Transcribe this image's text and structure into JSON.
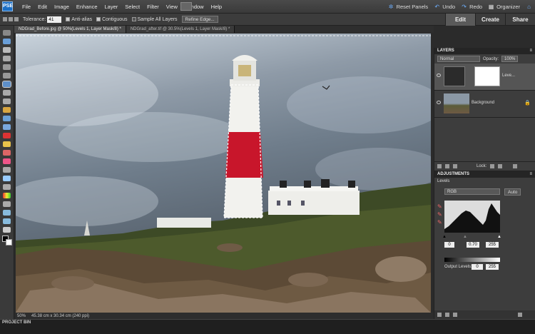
{
  "app": {
    "logo_text": "PSE"
  },
  "menu": [
    "File",
    "Edit",
    "Image",
    "Enhance",
    "Layer",
    "Select",
    "Filter",
    "View",
    "Window",
    "Help"
  ],
  "top_actions": {
    "reset_panels": "Reset Panels",
    "undo": "Undo",
    "redo": "Redo",
    "organizer": "Organizer"
  },
  "modes": {
    "edit": "Edit",
    "create": "Create",
    "share": "Share"
  },
  "options": {
    "tolerance_label": "Tolerance:",
    "tolerance_value": "41",
    "anti_alias": "Anti-alias",
    "contiguous": "Contiguous",
    "sample_all": "Sample All Layers",
    "refine_edge": "Refine Edge..."
  },
  "doc_tabs": [
    {
      "label": "NDGrad_Before.jpg @ 50%(Levels 1, Layer Mask/8) *",
      "active": true
    },
    {
      "label": "NDGrad_after.tif @ 30.5%(Levels 1, Layer Mask/8) *",
      "active": false
    }
  ],
  "status": {
    "zoom": "50%",
    "size": "45.38 cm x 30.34 cm (240 ppi)"
  },
  "project_bin": "PROJECT BIN",
  "layers_panel": {
    "title": "LAYERS",
    "blend_mode": "Normal",
    "opacity_label": "Opacity:",
    "opacity_value": "100%",
    "layers": [
      {
        "name": "Leve...",
        "selected": true
      },
      {
        "name": "Background",
        "selected": false
      }
    ],
    "lock_label": "Lock:"
  },
  "adjustments_panel": {
    "title": "ADJUSTMENTS",
    "type": "Levels",
    "channel": "RGB",
    "auto_label": "Auto",
    "input_black": "0",
    "input_mid": "0.70",
    "input_white": "255",
    "output_label": "Output Levels:",
    "output_black": "0",
    "output_white": "255"
  },
  "colors": {
    "accent_blue": "#1b6fc6",
    "panel_bg": "#3d3d3d",
    "lighthouse_red": "#c8162b"
  }
}
